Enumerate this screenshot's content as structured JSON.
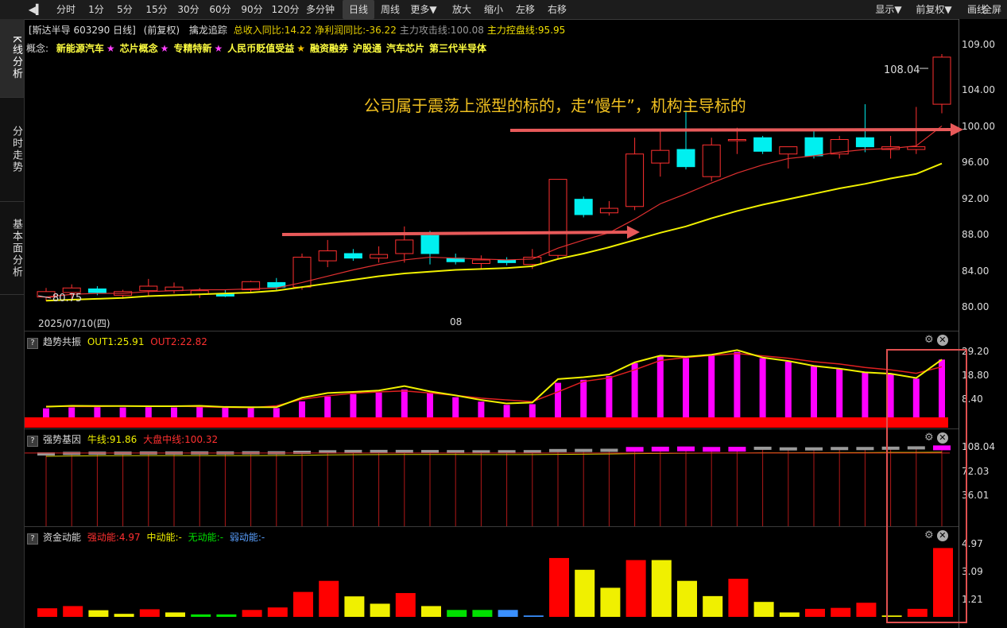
{
  "toolbar": {
    "items": [
      "分时",
      "1分",
      "5分",
      "15分",
      "30分",
      "60分",
      "90分",
      "120分",
      "多分钟",
      "日线",
      "周线",
      "更多▼",
      "放大",
      "缩小",
      "左移",
      "右移"
    ],
    "active": "日线",
    "right_items": [
      "显示▼",
      "前复权▼",
      "画线",
      "全屏"
    ]
  },
  "sidebar": {
    "tabs": [
      "K线分析",
      "分时走势",
      "基本面分析"
    ]
  },
  "main": {
    "stock_label": "[斯达半导 603290 日线]",
    "adjust_label": "(前复权)",
    "indicator_name": "擒龙追踪",
    "metrics": [
      {
        "label": "总收入同比:",
        "value": "14.22",
        "color": "#e8d000"
      },
      {
        "label": "净利润同比:",
        "value": "-36.22",
        "color": "#e8d000"
      },
      {
        "label": "主力攻击线:",
        "value": "100.08",
        "color": "#9a9a9a"
      },
      {
        "label": "主力控盘线:",
        "value": "95.95",
        "color": "#f0e000"
      }
    ],
    "concept_label": "概念:",
    "concepts": [
      "新能源汽车",
      "芯片概念",
      "专精特新",
      "人民币贬值受益",
      "融资融券",
      "沪股通",
      "汽车芯片",
      "第三代半导体"
    ],
    "annotation": "公司属于震荡上涨型的标的，走“慢牛”，机构主导标的",
    "high_label": "108.04",
    "low_label": "80.75",
    "date_start": "2025/07/10(四)",
    "date_mid": "08"
  },
  "panels": {
    "trend": {
      "name": "趋势共振",
      "out1_label": "OUT1:",
      "out1": "25.91",
      "out2_label": "OUT2:",
      "out2": "22.82"
    },
    "gene": {
      "name": "强势基因",
      "bull_label": "牛线:",
      "bull": "91.86",
      "market_label": "大盘中线:",
      "market": "100.32"
    },
    "fund": {
      "name": "资金动能",
      "strong_label": "强动能:",
      "strong": "4.97",
      "mid_label": "中动能:",
      "mid": "-",
      "none_label": "无动能:",
      "none": "-",
      "weak_label": "弱动能:",
      "weak": "-"
    }
  },
  "yaxis": {
    "main": [
      "109.00",
      "104.00",
      "100.00",
      "96.00",
      "92.00",
      "88.00",
      "84.00",
      "80.00"
    ],
    "trend": [
      "29.20",
      "18.80",
      "8.40"
    ],
    "gene": [
      "108.04",
      "72.03",
      "36.01"
    ],
    "fund": [
      "4.97",
      "3.09",
      "1.21"
    ]
  },
  "colors": {
    "up": "#ff3030",
    "down": "#00f0f0",
    "yellow": "#f0f000",
    "magenta": "#ff00ff",
    "red": "#ff0000",
    "green": "#00e000",
    "blue": "#3a90ff",
    "highlight": "#e05050"
  },
  "chart_data": [
    {
      "type": "candlestick",
      "ylim": [
        79.5,
        110.5
      ],
      "candles": [
        {
          "o": 81.8,
          "h": 82.2,
          "l": 80.75,
          "c": 81.2,
          "up": true
        },
        {
          "o": 81.7,
          "h": 82.6,
          "l": 81.0,
          "c": 82.2,
          "up": true
        },
        {
          "o": 82.1,
          "h": 82.4,
          "l": 81.4,
          "c": 81.7,
          "up": false
        },
        {
          "o": 81.4,
          "h": 82.0,
          "l": 81.0,
          "c": 81.8,
          "up": true
        },
        {
          "o": 81.9,
          "h": 83.2,
          "l": 81.3,
          "c": 82.4,
          "up": true
        },
        {
          "o": 81.9,
          "h": 82.8,
          "l": 81.6,
          "c": 82.3,
          "up": true
        },
        {
          "o": 81.5,
          "h": 82.2,
          "l": 81.1,
          "c": 81.9,
          "up": true
        },
        {
          "o": 81.6,
          "h": 82.0,
          "l": 81.2,
          "c": 81.3,
          "up": false
        },
        {
          "o": 82.0,
          "h": 83.0,
          "l": 81.7,
          "c": 82.9,
          "up": true
        },
        {
          "o": 82.8,
          "h": 83.3,
          "l": 82.0,
          "c": 82.3,
          "up": false
        },
        {
          "o": 82.3,
          "h": 86.0,
          "l": 82.0,
          "c": 85.6,
          "up": true
        },
        {
          "o": 85.2,
          "h": 87.5,
          "l": 84.5,
          "c": 86.3,
          "up": true
        },
        {
          "o": 86.0,
          "h": 86.5,
          "l": 85.2,
          "c": 85.5,
          "up": false
        },
        {
          "o": 85.5,
          "h": 86.8,
          "l": 85.0,
          "c": 85.9,
          "up": true
        },
        {
          "o": 86.0,
          "h": 89.0,
          "l": 85.0,
          "c": 87.5,
          "up": true
        },
        {
          "o": 88.0,
          "h": 88.5,
          "l": 84.8,
          "c": 86.0,
          "up": false
        },
        {
          "o": 85.5,
          "h": 86.0,
          "l": 84.8,
          "c": 85.1,
          "up": false
        },
        {
          "o": 84.9,
          "h": 85.8,
          "l": 84.3,
          "c": 85.3,
          "up": true
        },
        {
          "o": 85.3,
          "h": 85.6,
          "l": 84.7,
          "c": 85.0,
          "up": false
        },
        {
          "o": 84.8,
          "h": 86.5,
          "l": 84.3,
          "c": 85.6,
          "up": true
        },
        {
          "o": 85.8,
          "h": 93.0,
          "l": 85.4,
          "c": 94.2,
          "up": true
        },
        {
          "o": 92.0,
          "h": 92.3,
          "l": 90.0,
          "c": 90.3,
          "up": false
        },
        {
          "o": 90.5,
          "h": 91.8,
          "l": 90.2,
          "c": 91.0,
          "up": true
        },
        {
          "o": 91.2,
          "h": 98.8,
          "l": 90.8,
          "c": 97.0,
          "up": true
        },
        {
          "o": 96.0,
          "h": 99.5,
          "l": 94.5,
          "c": 97.4,
          "up": true
        },
        {
          "o": 97.5,
          "h": 101.8,
          "l": 95.3,
          "c": 95.6,
          "up": false
        },
        {
          "o": 94.5,
          "h": 98.8,
          "l": 94.0,
          "c": 98.0,
          "up": true
        },
        {
          "o": 98.5,
          "h": 99.9,
          "l": 97.0,
          "c": 98.6,
          "up": true
        },
        {
          "o": 98.8,
          "h": 99.0,
          "l": 97.0,
          "c": 97.3,
          "up": false
        },
        {
          "o": 97.0,
          "h": 97.8,
          "l": 95.4,
          "c": 97.8,
          "up": true
        },
        {
          "o": 98.8,
          "h": 99.5,
          "l": 96.5,
          "c": 96.8,
          "up": false
        },
        {
          "o": 97.0,
          "h": 99.0,
          "l": 96.5,
          "c": 98.6,
          "up": true
        },
        {
          "o": 98.8,
          "h": 102.5,
          "l": 97.2,
          "c": 97.8,
          "up": false
        },
        {
          "o": 97.5,
          "h": 99.0,
          "l": 96.5,
          "c": 97.8,
          "up": true
        },
        {
          "o": 97.8,
          "h": 102.2,
          "l": 97.0,
          "c": 97.5,
          "up": true
        },
        {
          "o": 102.5,
          "h": 108.04,
          "l": 101.5,
          "c": 107.7,
          "up": true
        }
      ],
      "ma_red": [
        81.2,
        81.5,
        81.6,
        81.6,
        81.8,
        81.9,
        82.0,
        82.0,
        82.1,
        82.2,
        82.8,
        83.5,
        84.2,
        84.8,
        85.3,
        85.6,
        85.5,
        85.4,
        85.3,
        85.4,
        86.6,
        87.5,
        88.3,
        89.8,
        91.5,
        92.6,
        93.8,
        94.9,
        95.8,
        96.5,
        96.8,
        97.2,
        97.5,
        97.6,
        97.9,
        100.1
      ],
      "ma_yellow": [
        80.8,
        80.9,
        81.0,
        81.1,
        81.3,
        81.4,
        81.5,
        81.6,
        81.7,
        81.9,
        82.3,
        82.7,
        83.1,
        83.5,
        83.8,
        84.0,
        84.2,
        84.3,
        84.4,
        84.6,
        85.4,
        86.0,
        86.7,
        87.5,
        88.3,
        89.0,
        89.9,
        90.7,
        91.4,
        92.0,
        92.6,
        93.2,
        93.7,
        94.3,
        94.8,
        95.95
      ]
    },
    {
      "type": "bar",
      "name": "趋势共振",
      "ylim": [
        0,
        31.5
      ],
      "values": [
        4.9,
        5.3,
        5.4,
        5.3,
        5.4,
        5.3,
        5.5,
        5.2,
        5.1,
        5.0,
        7.9,
        10.0,
        11.0,
        11.7,
        13.0,
        11.6,
        9.7,
        7.8,
        6.4,
        6.7,
        15.9,
        17.2,
        18.8,
        24.4,
        27.2,
        26.5,
        27.7,
        29.2,
        26.5,
        25.0,
        23.0,
        21.8,
        20.2,
        19.6,
        17.7,
        25.91
      ],
      "out1": [
        5.6,
        6.0,
        5.9,
        5.9,
        5.8,
        5.8,
        6.0,
        5.5,
        5.4,
        5.4,
        9.5,
        11.5,
        12.0,
        12.6,
        14.5,
        12.2,
        10.5,
        8.5,
        7.0,
        7.4,
        17.5,
        18.3,
        19.5,
        24.7,
        27.6,
        27.1,
        28.0,
        30.0,
        26.8,
        25.3,
        23.2,
        22.0,
        20.4,
        19.8,
        18.0,
        25.91
      ],
      "out2": [
        5.8,
        5.7,
        5.7,
        5.9,
        5.8,
        5.9,
        5.6,
        5.3,
        5.2,
        6.0,
        8.8,
        10.3,
        11.4,
        12.0,
        12.4,
        11.5,
        10.5,
        9.3,
        8.5,
        7.8,
        12.0,
        16.5,
        18.0,
        21.5,
        25.5,
        26.8,
        27.7,
        28.5,
        27.5,
        26.5,
        25.0,
        24.0,
        22.5,
        21.5,
        20.0,
        22.82
      ]
    },
    {
      "type": "bar",
      "name": "强势基因",
      "ylim": [
        0,
        112
      ],
      "values": [
        97.8,
        98.6,
        98.9,
        99.0,
        99.2,
        99.2,
        99.3,
        99.3,
        99.5,
        99.5,
        100.2,
        101.0,
        101.5,
        101.5,
        101.5,
        101.3,
        101.2,
        101.0,
        101.1,
        101.2,
        102.8,
        103.0,
        103.2,
        105.8,
        106.2,
        106.5,
        105.8,
        106.0,
        106.2,
        105.3,
        105.3,
        105.8,
        105.8,
        106.3,
        106.8,
        108.04
      ],
      "bull": [
        95.5,
        96.0,
        96.3,
        96.4,
        96.5,
        96.5,
        96.6,
        96.6,
        96.6,
        96.7,
        97.0,
        97.5,
        97.8,
        98.0,
        98.1,
        98.1,
        98.1,
        98.0,
        98.0,
        98.0,
        98.3,
        98.6,
        98.9,
        99.4,
        99.8,
        100.1,
        100.3,
        100.4,
        100.6,
        100.7,
        100.8,
        100.9,
        101.0,
        101.2,
        101.3,
        101.5
      ],
      "magenta_days": [
        23,
        24,
        25,
        26,
        27,
        35
      ]
    },
    {
      "type": "bar",
      "name": "资金动能",
      "ylim": [
        0,
        5.05
      ],
      "values": [
        0.62,
        0.78,
        0.48,
        0.22,
        0.55,
        0.32,
        0.18,
        0.18,
        0.5,
        0.68,
        1.8,
        2.6,
        1.48,
        0.95,
        1.72,
        0.78,
        0.5,
        0.5,
        0.5,
        0.1,
        4.25,
        3.4,
        2.1,
        4.1,
        4.1,
        2.6,
        1.5,
        2.75,
        1.08,
        0.32,
        0.58,
        0.65,
        1.02,
        0.1,
        0.58,
        4.97
      ],
      "colors": [
        "red",
        "red",
        "yellow",
        "yellow",
        "red",
        "yellow",
        "green",
        "green",
        "red",
        "red",
        "red",
        "red",
        "yellow",
        "yellow",
        "red",
        "yellow",
        "green",
        "green",
        "blue",
        "blue",
        "red",
        "yellow",
        "yellow",
        "red",
        "yellow",
        "yellow",
        "yellow",
        "red",
        "yellow",
        "yellow",
        "red",
        "red",
        "red",
        "yellow",
        "red",
        "red"
      ]
    }
  ]
}
